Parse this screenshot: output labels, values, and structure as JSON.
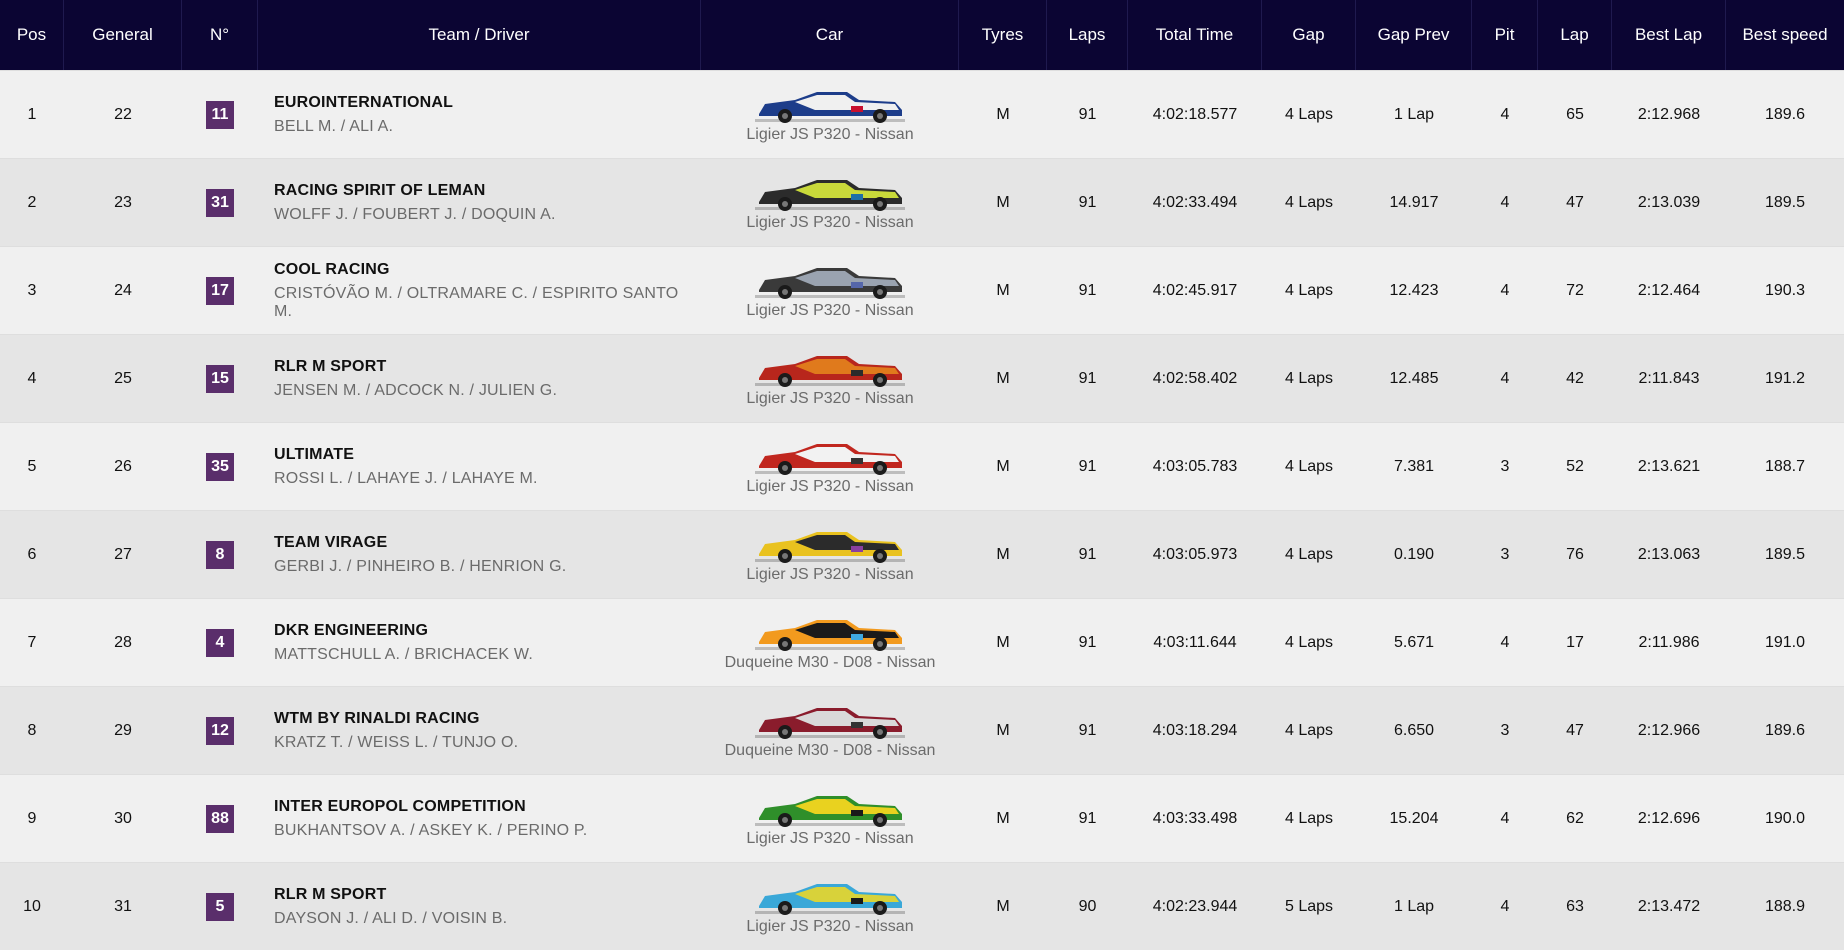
{
  "header": {
    "pos": "Pos",
    "general": "General",
    "number": "N°",
    "team": "Team / Driver",
    "car": "Car",
    "tyres": "Tyres",
    "laps": "Laps",
    "total_time": "Total Time",
    "gap": "Gap",
    "gap_prev": "Gap Prev",
    "pit": "Pit",
    "lap": "Lap",
    "best_lap": "Best Lap",
    "best_speed": "Best speed"
  },
  "colors": {
    "header_bg": "#0b0533",
    "badge_bg": "#5a2e6b",
    "row_light": "#f0f0f0",
    "row_dark": "#e5e5e5"
  },
  "rows": [
    {
      "pos": "1",
      "general": "22",
      "number": "11",
      "team": "EUROINTERNATIONAL",
      "drivers": "BELL M. / ALI A.",
      "car": "Ligier JS P320 - Nissan",
      "car_colors": [
        "#1d3d8a",
        "#f0f0f0",
        "#c8102e"
      ],
      "tyres": "M",
      "laps": "91",
      "total_time": "4:02:18.577",
      "gap": "4 Laps",
      "gap_prev": "1 Lap",
      "pit": "4",
      "lap": "65",
      "best_lap": "2:12.968",
      "best_speed": "189.6"
    },
    {
      "pos": "2",
      "general": "23",
      "number": "31",
      "team": "RACING SPIRIT OF LEMAN",
      "drivers": "WOLFF J. / FOUBERT J. / DOQUIN A.",
      "car": "Ligier JS P320 - Nissan",
      "car_colors": [
        "#2b2b2b",
        "#c9d93a",
        "#1e6fa8"
      ],
      "tyres": "M",
      "laps": "91",
      "total_time": "4:02:33.494",
      "gap": "4 Laps",
      "gap_prev": "14.917",
      "pit": "4",
      "lap": "47",
      "best_lap": "2:13.039",
      "best_speed": "189.5"
    },
    {
      "pos": "3",
      "general": "24",
      "number": "17",
      "team": "COOL RACING",
      "drivers": "CRISTÓVÃO M. / OLTRAMARE C. / ESPIRITO SANTO M.",
      "car": "Ligier JS P320 - Nissan",
      "car_colors": [
        "#3a3a3a",
        "#9aa3b0",
        "#5566aa"
      ],
      "tyres": "M",
      "laps": "91",
      "total_time": "4:02:45.917",
      "gap": "4 Laps",
      "gap_prev": "12.423",
      "pit": "4",
      "lap": "72",
      "best_lap": "2:12.464",
      "best_speed": "190.3"
    },
    {
      "pos": "4",
      "general": "25",
      "number": "15",
      "team": "RLR M SPORT",
      "drivers": "JENSEN M. / ADCOCK N. / JULIEN G.",
      "car": "Ligier JS P320 - Nissan",
      "car_colors": [
        "#b8261c",
        "#e07a1c",
        "#2b2b2b"
      ],
      "tyres": "M",
      "laps": "91",
      "total_time": "4:02:58.402",
      "gap": "4 Laps",
      "gap_prev": "12.485",
      "pit": "4",
      "lap": "42",
      "best_lap": "2:11.843",
      "best_speed": "191.2"
    },
    {
      "pos": "5",
      "general": "26",
      "number": "35",
      "team": "ULTIMATE",
      "drivers": "ROSSI L. / LAHAYE J. / LAHAYE M.",
      "car": "Ligier JS P320 - Nissan",
      "car_colors": [
        "#c1271f",
        "#f2f2f2",
        "#333333"
      ],
      "tyres": "M",
      "laps": "91",
      "total_time": "4:03:05.783",
      "gap": "4 Laps",
      "gap_prev": "7.381",
      "pit": "3",
      "lap": "52",
      "best_lap": "2:13.621",
      "best_speed": "188.7"
    },
    {
      "pos": "6",
      "general": "27",
      "number": "8",
      "team": "TEAM VIRAGE",
      "drivers": "GERBI J. / PINHEIRO B. / HENRION G.",
      "car": "Ligier JS P320 - Nissan",
      "car_colors": [
        "#e9c21f",
        "#2b2b2b",
        "#8a3fa0"
      ],
      "tyres": "M",
      "laps": "91",
      "total_time": "4:03:05.973",
      "gap": "4 Laps",
      "gap_prev": "0.190",
      "pit": "3",
      "lap": "76",
      "best_lap": "2:13.063",
      "best_speed": "189.5"
    },
    {
      "pos": "7",
      "general": "28",
      "number": "4",
      "team": "DKR ENGINEERING",
      "drivers": "MATTSCHULL A. / BRICHACEK W.",
      "car": "Duqueine M30 - D08 - Nissan",
      "car_colors": [
        "#f29a1e",
        "#1a1a1a",
        "#3fa9e0"
      ],
      "tyres": "M",
      "laps": "91",
      "total_time": "4:03:11.644",
      "gap": "4 Laps",
      "gap_prev": "5.671",
      "pit": "4",
      "lap": "17",
      "best_lap": "2:11.986",
      "best_speed": "191.0"
    },
    {
      "pos": "8",
      "general": "29",
      "number": "12",
      "team": "WTM BY RINALDI RACING",
      "drivers": "KRATZ T. / WEISS L. / TUNJO O.",
      "car": "Duqueine M30 - D08 - Nissan",
      "car_colors": [
        "#8a1c2c",
        "#d9d9d9",
        "#333333"
      ],
      "tyres": "M",
      "laps": "91",
      "total_time": "4:03:18.294",
      "gap": "4 Laps",
      "gap_prev": "6.650",
      "pit": "3",
      "lap": "47",
      "best_lap": "2:12.966",
      "best_speed": "189.6"
    },
    {
      "pos": "9",
      "general": "30",
      "number": "88",
      "team": "INTER EUROPOL COMPETITION",
      "drivers": "BUKHANTSOV A. / ASKEY K. / PERINO P.",
      "car": "Ligier JS P320 - Nissan",
      "car_colors": [
        "#2f8f2a",
        "#e9d21f",
        "#1a1a1a"
      ],
      "tyres": "M",
      "laps": "91",
      "total_time": "4:03:33.498",
      "gap": "4 Laps",
      "gap_prev": "15.204",
      "pit": "4",
      "lap": "62",
      "best_lap": "2:12.696",
      "best_speed": "190.0"
    },
    {
      "pos": "10",
      "general": "31",
      "number": "5",
      "team": "RLR M SPORT",
      "drivers": "DAYSON J. / ALI D. / VOISIN B.",
      "car": "Ligier JS P320 - Nissan",
      "car_colors": [
        "#3aa8d8",
        "#d8d23a",
        "#1a1a1a"
      ],
      "tyres": "M",
      "laps": "90",
      "total_time": "4:02:23.944",
      "gap": "5 Laps",
      "gap_prev": "1 Lap",
      "pit": "4",
      "lap": "63",
      "best_lap": "2:13.472",
      "best_speed": "188.9"
    }
  ]
}
